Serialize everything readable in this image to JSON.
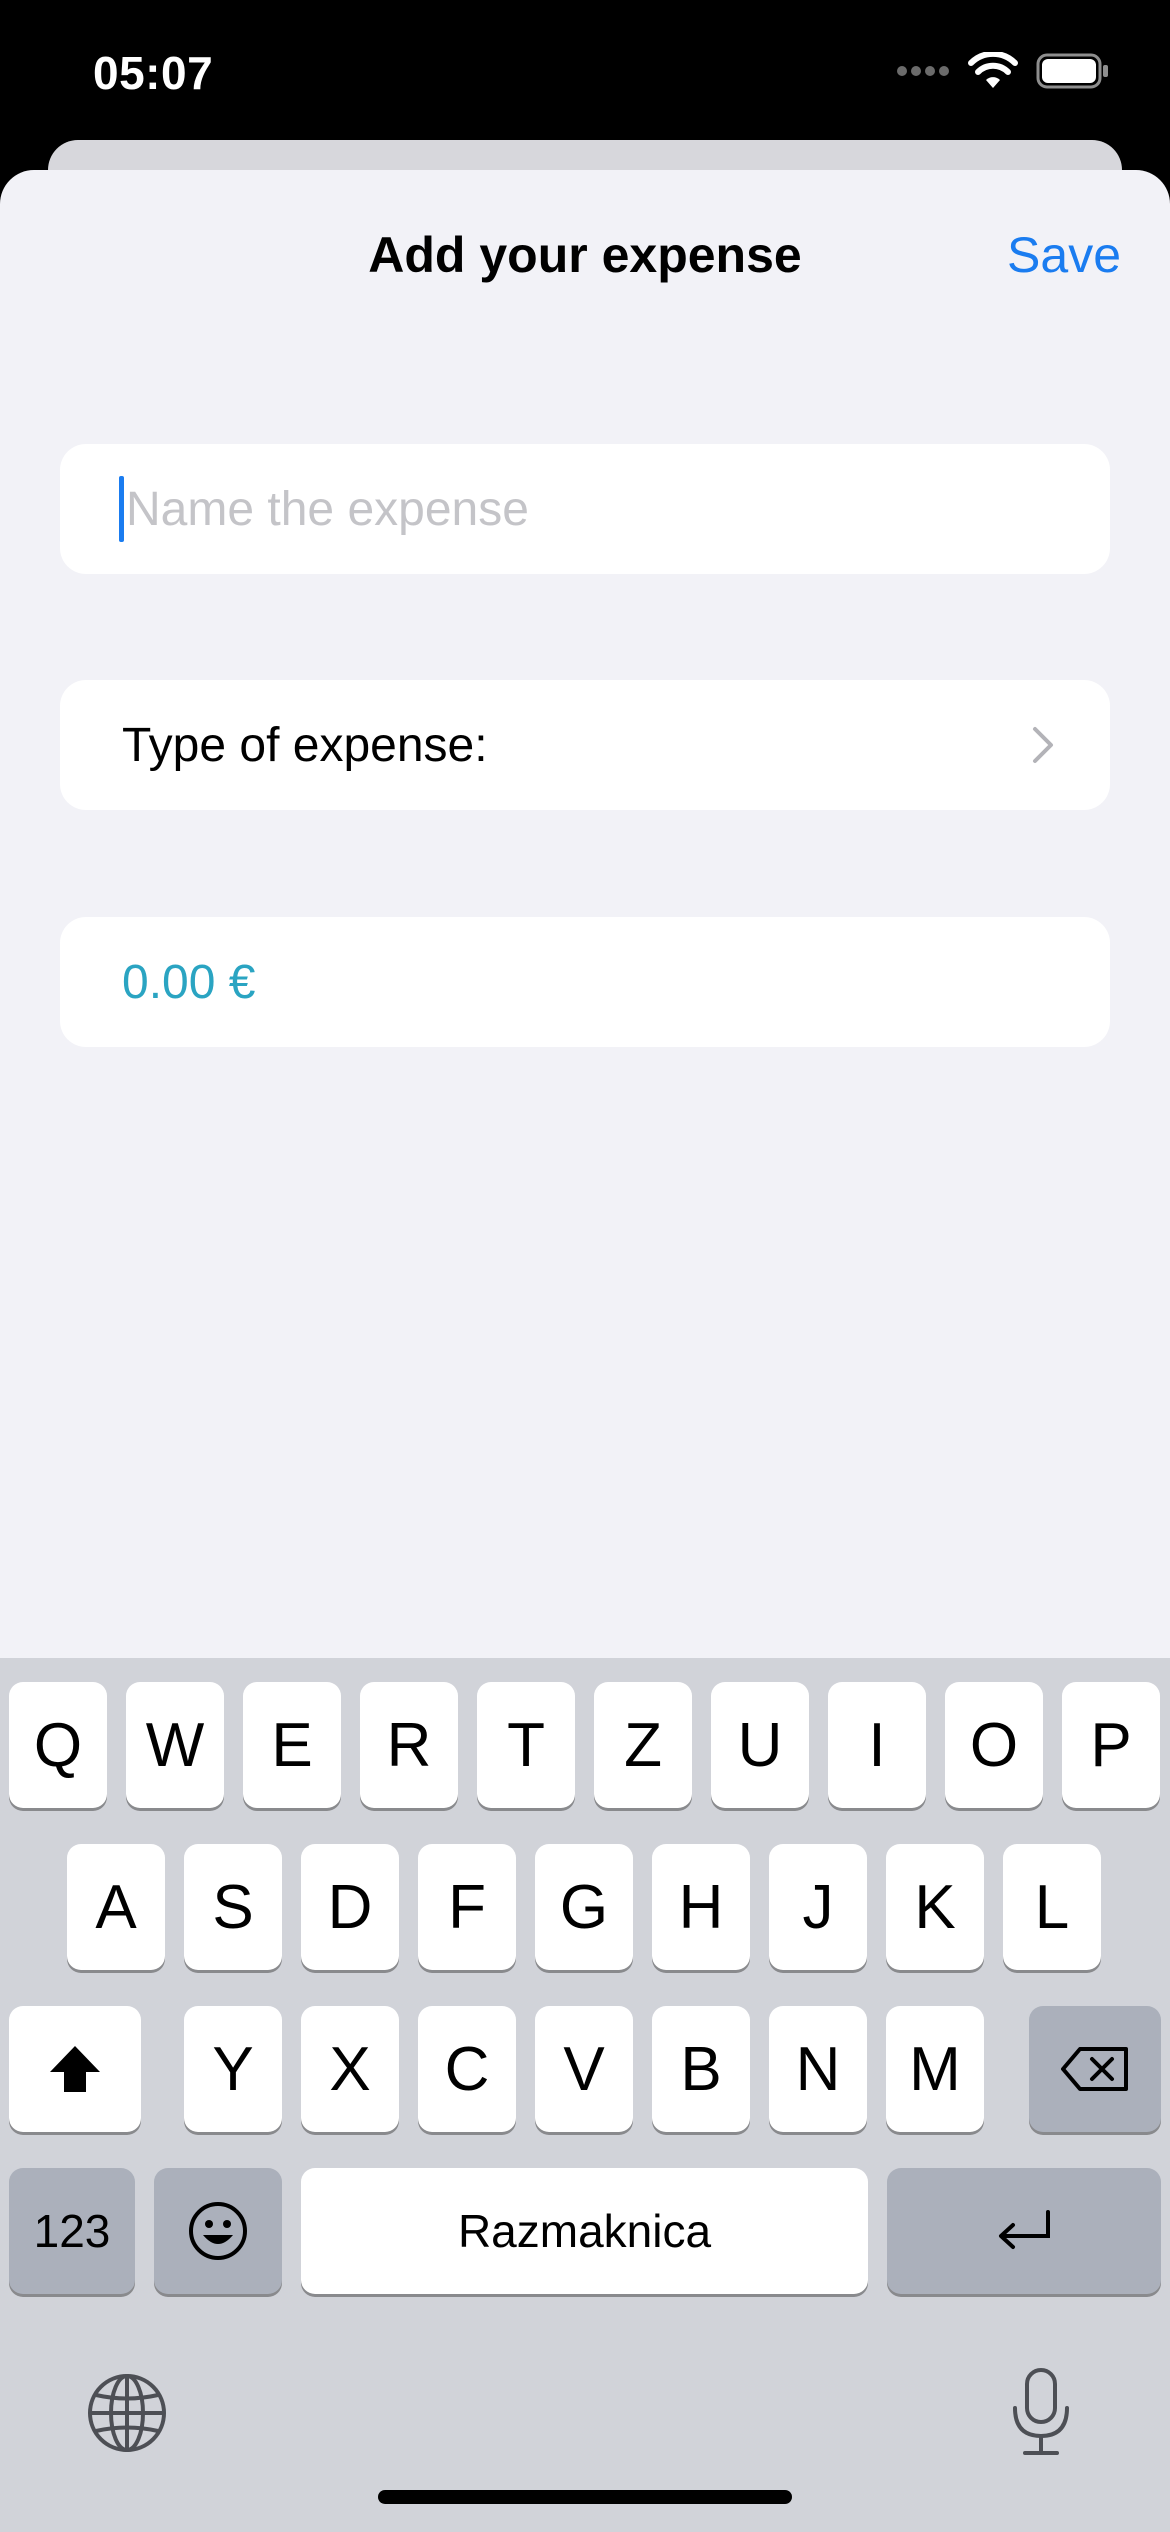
{
  "status": {
    "time": "05:07",
    "icons": [
      "signal-dots-icon",
      "wifi-icon",
      "battery-icon"
    ]
  },
  "nav": {
    "title": "Add your expense",
    "save_label": "Save"
  },
  "form": {
    "name_placeholder": "Name the expense",
    "name_value": "",
    "type_label": "Type of expense:",
    "amount": "0.00 €"
  },
  "colors": {
    "accent": "#1a7cf0",
    "amount": "#2aa4c2",
    "sheet_bg": "#f2f2f7",
    "keyboard_bg": "#d1d3d9"
  },
  "keyboard": {
    "row1": [
      "Q",
      "W",
      "E",
      "R",
      "T",
      "Z",
      "U",
      "I",
      "O",
      "P"
    ],
    "row2": [
      "A",
      "S",
      "D",
      "F",
      "G",
      "H",
      "J",
      "K",
      "L"
    ],
    "row3": [
      "Y",
      "X",
      "C",
      "V",
      "B",
      "N",
      "M"
    ],
    "numbers_label": "123",
    "space_label": "Razmaknica",
    "icons": [
      "shift-icon",
      "backspace-icon",
      "emoji-icon",
      "return-icon",
      "globe-icon",
      "microphone-icon"
    ]
  }
}
